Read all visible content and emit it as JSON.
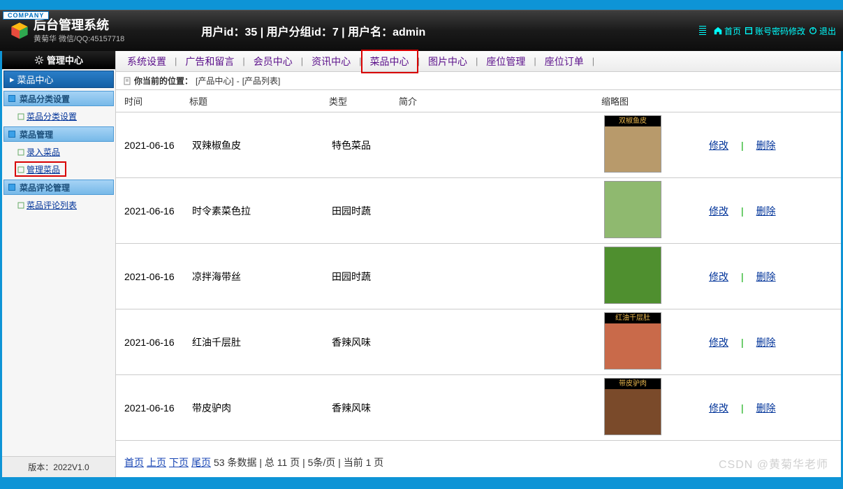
{
  "company_tag": "COMPANY",
  "header": {
    "title": "后台管理系统",
    "subtitle": "黄菊华 微信/QQ:45157718",
    "user_bar": "用户id：35 | 用户分组id：7 | 用户名：admin",
    "home": "首页",
    "account_mod": "账号密码修改",
    "logout": "退出"
  },
  "sidebar": {
    "head": "管理中心",
    "current": "菜品中心",
    "groups": [
      {
        "title": "菜品分类设置",
        "items": [
          "菜品分类设置"
        ]
      },
      {
        "title": "菜品管理",
        "items": [
          "录入菜品",
          "管理菜品"
        ]
      },
      {
        "title": "菜品评论管理",
        "items": [
          "菜品评论列表"
        ]
      }
    ],
    "version": "版本：2022V1.0"
  },
  "tabs": [
    "系统设置",
    "广告和留言",
    "会员中心",
    "资讯中心",
    "菜品中心",
    "图片中心",
    "座位管理",
    "座位订单"
  ],
  "active_tab_index": 4,
  "path": {
    "label": "你当前的位置：",
    "module": "[产品中心]",
    "sep": "-",
    "page": "[产品列表]"
  },
  "columns": [
    "时间",
    "标题",
    "类型",
    "简介",
    "缩略图"
  ],
  "rows": [
    {
      "date": "2021-06-16",
      "title": "双辣椒鱼皮",
      "type": "特色菜品",
      "intro": "",
      "thumb_label": "双椒鱼皮",
      "thumb_bg": "#B89A6B"
    },
    {
      "date": "2021-06-16",
      "title": "时令素菜色拉",
      "type": "田园时蔬",
      "intro": "",
      "thumb_label": "",
      "thumb_bg": "#8FB96F"
    },
    {
      "date": "2021-06-16",
      "title": "凉拌海带丝",
      "type": "田园时蔬",
      "intro": "",
      "thumb_label": "",
      "thumb_bg": "#4F8F2F"
    },
    {
      "date": "2021-06-16",
      "title": "红油千层肚",
      "type": "香辣风味",
      "intro": "",
      "thumb_label": "红油千层肚",
      "thumb_bg": "#C96A4A"
    },
    {
      "date": "2021-06-16",
      "title": "带皮驴肉",
      "type": "香辣风味",
      "intro": "",
      "thumb_label": "带皮驴肉",
      "thumb_bg": "#7A4A2A"
    }
  ],
  "ops": {
    "edit": "修改",
    "del": "删除"
  },
  "pager": {
    "first": "首页",
    "prev": "上页",
    "next": "下页",
    "last": "尾页",
    "info": "53 条数据 | 总 11 页 | 5条/页 | 当前 1 页"
  },
  "watermark": "CSDN @黄菊华老师"
}
